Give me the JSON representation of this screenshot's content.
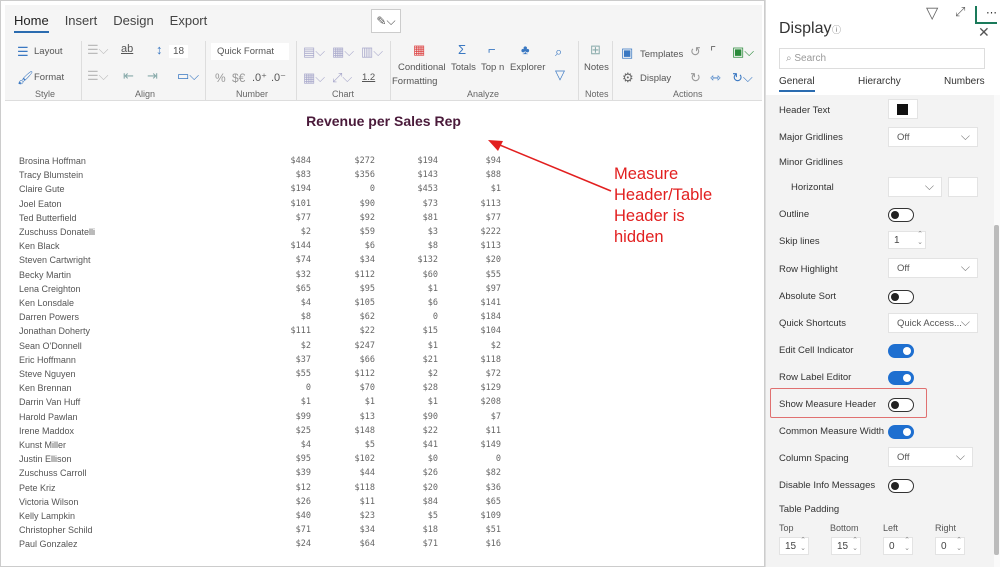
{
  "ribbon": {
    "tabs": [
      "Home",
      "Insert",
      "Design",
      "Export"
    ],
    "style": {
      "layout": "Layout",
      "format": "Format",
      "group": "Style"
    },
    "align": {
      "group": "Align",
      "font_size": "18",
      "text_style": "ab"
    },
    "number": {
      "quick_format": "Quick Format",
      "percent": "%",
      "currency": "$€",
      "inc_decimal": ".0⁺",
      "dec_decimal": ".0⁻",
      "group": "Number"
    },
    "chart": {
      "scale": "1.2",
      "group": "Chart"
    },
    "analyze": {
      "conditional": "Conditional",
      "formatting": "Formatting",
      "totals": "Totals",
      "topn": "Top n",
      "explorer": "Explorer",
      "group": "Analyze"
    },
    "notes": {
      "label": "Notes",
      "group": "Notes"
    },
    "actions": {
      "templates": "Templates",
      "display": "Display",
      "group": "Actions"
    }
  },
  "report": {
    "title": "Revenue per Sales Rep",
    "rows": [
      [
        "Brosina Hoffman",
        "$484",
        "$272",
        "$194",
        "$94"
      ],
      [
        "Tracy Blumstein",
        "$83",
        "$356",
        "$143",
        "$88"
      ],
      [
        "Claire Gute",
        "$194",
        "0",
        "$453",
        "$1"
      ],
      [
        "Joel Eaton",
        "$101",
        "$90",
        "$73",
        "$113"
      ],
      [
        "Ted Butterfield",
        "$77",
        "$92",
        "$81",
        "$77"
      ],
      [
        "Zuschuss Donatelli",
        "$2",
        "$59",
        "$3",
        "$222"
      ],
      [
        "Ken Black",
        "$144",
        "$6",
        "$8",
        "$113"
      ],
      [
        "Steven Cartwright",
        "$74",
        "$34",
        "$132",
        "$20"
      ],
      [
        "Becky Martin",
        "$32",
        "$112",
        "$60",
        "$55"
      ],
      [
        "Lena Creighton",
        "$65",
        "$95",
        "$1",
        "$97"
      ],
      [
        "Ken Lonsdale",
        "$4",
        "$105",
        "$6",
        "$141"
      ],
      [
        "Darren Powers",
        "$8",
        "$62",
        "0",
        "$184"
      ],
      [
        "Jonathan Doherty",
        "$111",
        "$22",
        "$15",
        "$104"
      ],
      [
        "Sean O'Donnell",
        "$2",
        "$247",
        "$1",
        "$2"
      ],
      [
        "Eric Hoffmann",
        "$37",
        "$66",
        "$21",
        "$118"
      ],
      [
        "Steve Nguyen",
        "$55",
        "$112",
        "$2",
        "$72"
      ],
      [
        "Ken Brennan",
        "0",
        "$70",
        "$28",
        "$129"
      ],
      [
        "Darrin Van Huff",
        "$1",
        "$1",
        "$1",
        "$208"
      ],
      [
        "Harold Pawlan",
        "$99",
        "$13",
        "$90",
        "$7"
      ],
      [
        "Irene Maddox",
        "$25",
        "$148",
        "$22",
        "$11"
      ],
      [
        "Kunst Miller",
        "$4",
        "$5",
        "$41",
        "$149"
      ],
      [
        "Justin Ellison",
        "$95",
        "$102",
        "$0",
        "0"
      ],
      [
        "Zuschuss Carroll",
        "$39",
        "$44",
        "$26",
        "$82"
      ],
      [
        "Pete Kriz",
        "$12",
        "$118",
        "$20",
        "$36"
      ],
      [
        "Victoria Wilson",
        "$26",
        "$11",
        "$84",
        "$65"
      ],
      [
        "Kelly Lampkin",
        "$40",
        "$23",
        "$5",
        "$109"
      ],
      [
        "Christopher Schild",
        "$71",
        "$34",
        "$18",
        "$51"
      ],
      [
        "Paul Gonzalez",
        "$24",
        "$64",
        "$71",
        "$16"
      ]
    ]
  },
  "annotation": {
    "lines": [
      "Measure",
      "Header/Table",
      "Header is",
      "hidden"
    ],
    "color": "#e21f1f"
  },
  "panel": {
    "title": "Display",
    "search_placeholder": "Search",
    "tabs": [
      "General",
      "Hierarchy",
      "Numbers"
    ],
    "header_text": "Header Text",
    "major_gridlines": "Major Gridlines",
    "major_value": "Off",
    "minor_gridlines": "Minor Gridlines",
    "horizontal": "Horizontal",
    "outline": "Outline",
    "skip_lines": "Skip lines",
    "skip_value": "1",
    "row_highlight": "Row Highlight",
    "row_highlight_value": "Off",
    "absolute_sort": "Absolute Sort",
    "quick_shortcuts": "Quick Shortcuts",
    "quick_value": "Quick Access...",
    "edit_cell": "Edit Cell Indicator",
    "row_label_editor": "Row Label Editor",
    "show_measure_header": "Show Measure Header",
    "common_measure_width": "Common Measure Width",
    "column_spacing": "Column Spacing",
    "column_spacing_value": "Off",
    "disable_info": "Disable Info Messages",
    "table_padding": "Table Padding",
    "padding": {
      "top_label": "Top",
      "top": "15",
      "bottom_label": "Bottom",
      "bottom": "15",
      "left_label": "Left",
      "left": "0",
      "right_label": "Right",
      "right": "0"
    },
    "toggles": {
      "outline": false,
      "absolute_sort": false,
      "edit_cell": true,
      "row_label_editor": true,
      "show_measure_header": false,
      "common_measure_width": true,
      "disable_info": false
    }
  }
}
